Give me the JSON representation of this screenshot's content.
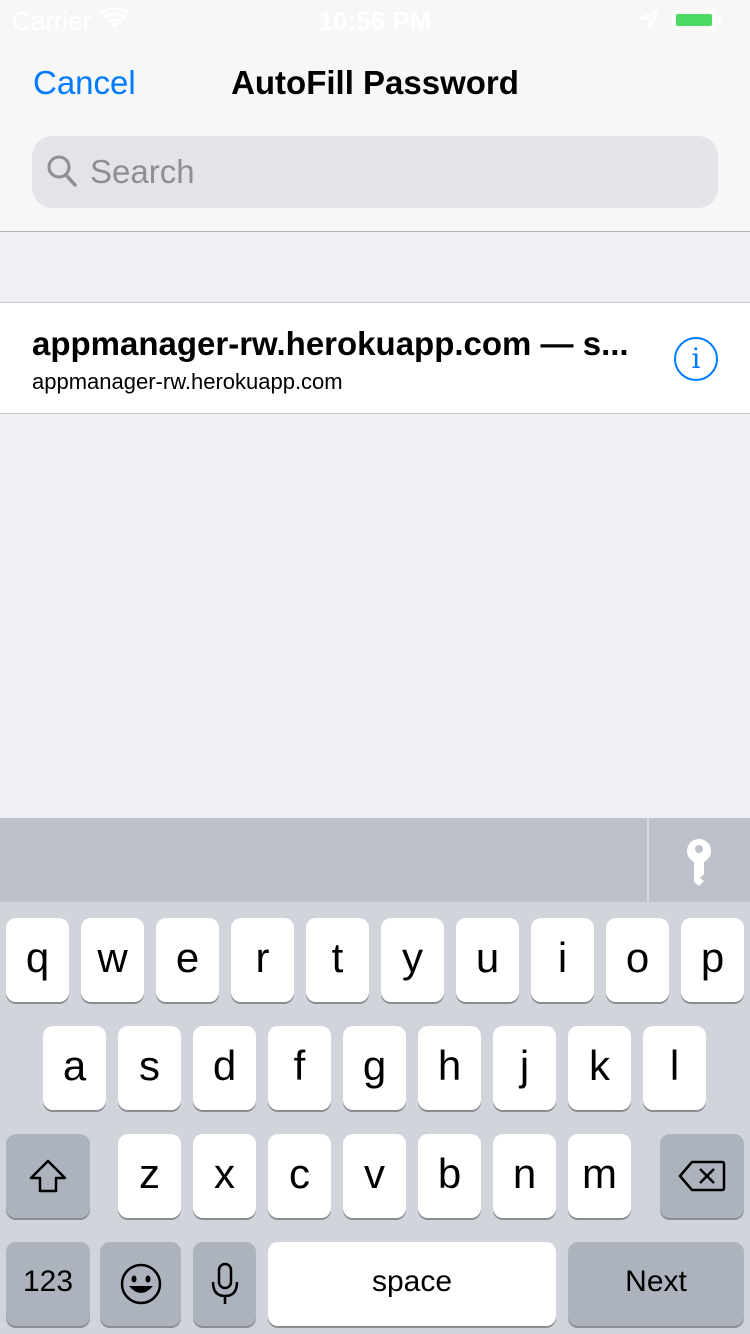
{
  "status_bar": {
    "carrier": "Carrier",
    "time": "10:56 PM"
  },
  "header": {
    "cancel_label": "Cancel",
    "title": "AutoFill Password"
  },
  "search": {
    "placeholder": "Search"
  },
  "list": {
    "items": [
      {
        "title": "appmanager-rw.herokuapp.com — s...",
        "subtitle": "appmanager-rw.herokuapp.com",
        "info_icon": "info-icon"
      }
    ]
  },
  "keyboard": {
    "row1": [
      "q",
      "w",
      "e",
      "r",
      "t",
      "y",
      "u",
      "i",
      "o",
      "p"
    ],
    "row2": [
      "a",
      "s",
      "d",
      "f",
      "g",
      "h",
      "j",
      "k",
      "l"
    ],
    "row3": [
      "z",
      "x",
      "c",
      "v",
      "b",
      "n",
      "m"
    ],
    "numbers_label": "123",
    "space_label": "space",
    "next_label": "Next",
    "toolbar_icon": "key-icon",
    "shift_icon": "shift-icon",
    "delete_icon": "delete-icon",
    "emoji_icon": "emoji-icon",
    "mic_icon": "microphone-icon"
  },
  "colors": {
    "accent": "#007aff",
    "battery": "#4cd964"
  }
}
